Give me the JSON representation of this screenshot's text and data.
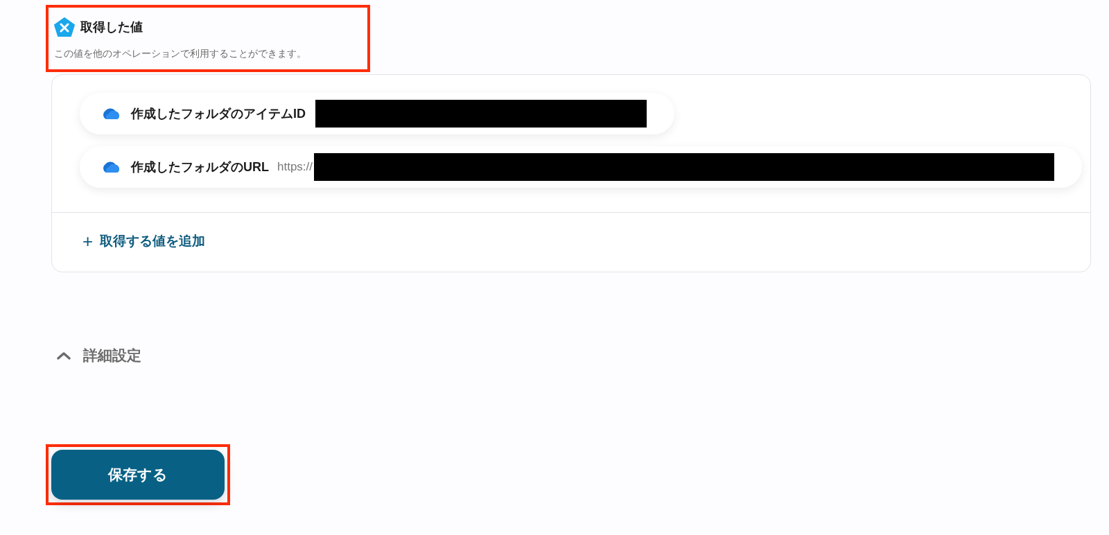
{
  "header": {
    "title": "取得した値",
    "description": "この値を他のオペレーションで利用することができます。",
    "highlighted": true
  },
  "values": [
    {
      "label": "作成したフォルダのアイテムID",
      "redacted": true
    },
    {
      "label": "作成したフォルダのURL",
      "prefix": "https://",
      "redacted": true
    }
  ],
  "add_value": {
    "icon": "+",
    "label": "取得する値を追加"
  },
  "advanced": {
    "label": "詳細設定",
    "expanded": true
  },
  "save_button": {
    "label": "保存する",
    "highlighted": true
  }
}
